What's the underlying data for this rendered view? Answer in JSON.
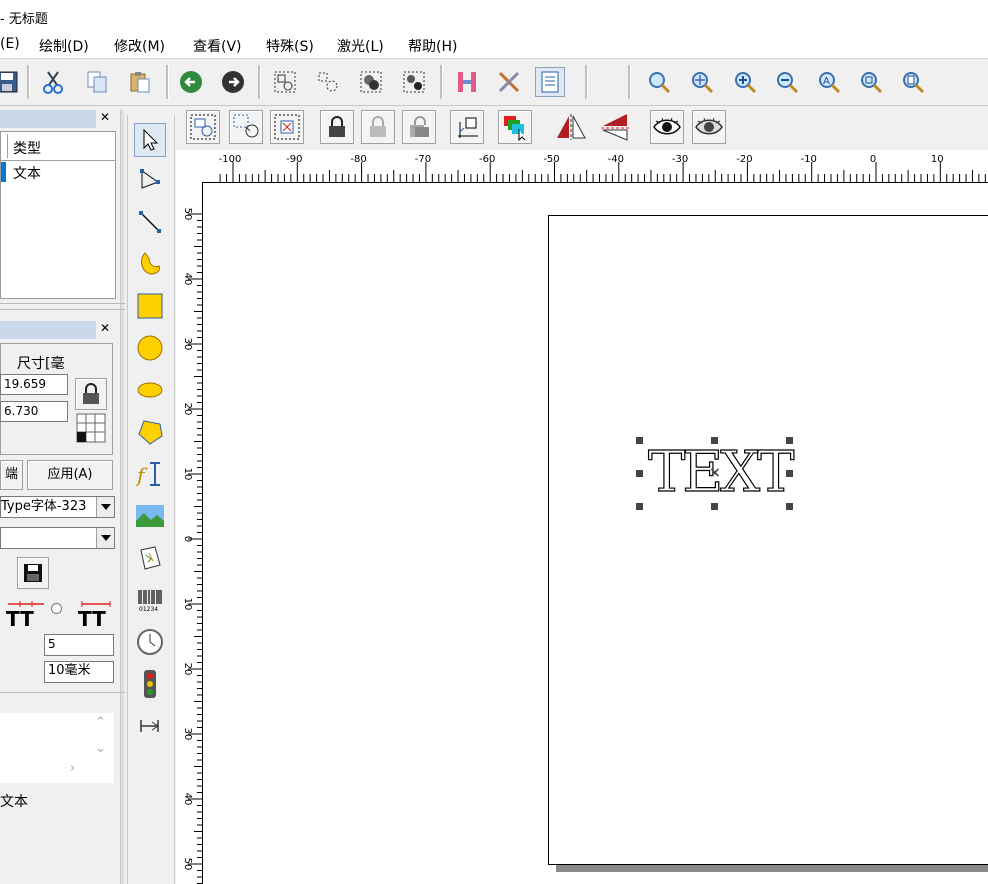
{
  "window": {
    "title": "- 无标题"
  },
  "menu": [
    {
      "label": "(E)"
    },
    {
      "label": "绘制(D)"
    },
    {
      "label": "修改(M)"
    },
    {
      "label": "查看(V)"
    },
    {
      "label": "特殊(S)"
    },
    {
      "label": "激光(L)"
    },
    {
      "label": "帮助(H)"
    }
  ],
  "object_list": {
    "column_header": "类型",
    "rows": [
      {
        "type": "文本"
      }
    ]
  },
  "properties": {
    "size_header": "尺寸[毫",
    "width_value": "19.659",
    "height_value": "6.730",
    "port_button": "端口",
    "apply_button": "应用(A)",
    "font_value": "Type字体-323",
    "second_combo_value": "",
    "char_spacing_value": "5",
    "line_height_value": "10毫米",
    "object_label": "文本"
  },
  "ruler": {
    "horizontal_ticks": [
      "-100",
      "-90",
      "-80",
      "-70",
      "-60",
      "-50",
      "-40",
      "-30",
      "-20",
      "-10",
      "0",
      "10"
    ],
    "vertical_ticks": [
      "50",
      "40",
      "30",
      "20",
      "10",
      "0",
      "10",
      "20",
      "30",
      "40",
      "50"
    ]
  },
  "canvas": {
    "text_object": "TEXT"
  },
  "colors": {
    "accent_blue": "#0078d7",
    "panel_title": "#c9d9ea",
    "handle": "#444444"
  }
}
